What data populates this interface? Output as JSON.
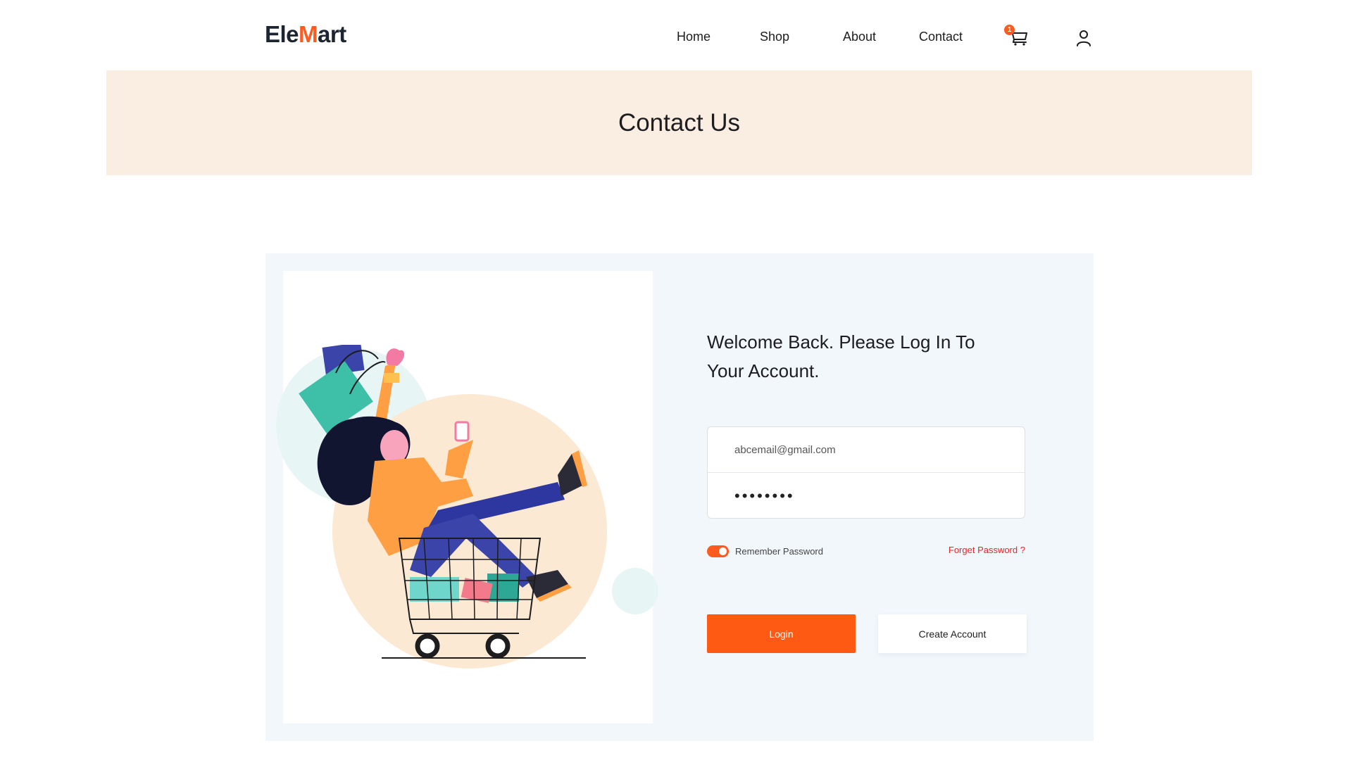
{
  "brand": {
    "logo_prefix": "Ele",
    "logo_mark": "M",
    "logo_suffix": "art",
    "accent_color": "#ff5a1f"
  },
  "nav": {
    "items": [
      {
        "label": "Home"
      },
      {
        "label": "Shop"
      },
      {
        "label": "About"
      },
      {
        "label": "Contact"
      }
    ],
    "cart_icon": "shopping-cart-icon",
    "cart_count": "1",
    "user_icon": "user-icon"
  },
  "banner": {
    "title": "Contact Us",
    "background": "#faede1"
  },
  "login": {
    "heading": "Welcome Back. Please Log In To Your Account.",
    "email_value": "abcemail@gmail.com",
    "password_value": "••••••••",
    "remember_label": "Remember Password",
    "remember_checked": true,
    "forgot_label": "Forget Password ?",
    "login_label": "Login",
    "create_label": "Create Account",
    "primary_color": "#ff5a14",
    "card_background": "#f2f7fc"
  },
  "illustration": {
    "icon": "shopping-woman-in-cart-illustration"
  }
}
